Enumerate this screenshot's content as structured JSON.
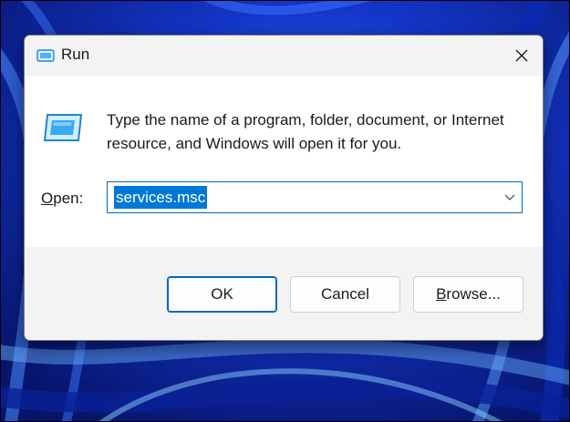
{
  "colors": {
    "wallpaper_base": "#0a1f8a",
    "accent": "#0067c0",
    "selection": "#0078d7",
    "dialog_bg": "#f3f3f3",
    "content_bg": "#ffffff"
  },
  "dialog": {
    "title": "Run",
    "title_icon": "run-icon",
    "close_icon": "close-icon",
    "program_icon": "run-program-icon",
    "description": "Type the name of a program, folder, document, or Internet resource, and Windows will open it for you.",
    "open_label_accel": "O",
    "open_label_rest": "pen:",
    "open_value": "services.msc",
    "dropdown_icon": "chevron-down-icon",
    "buttons": {
      "ok": "OK",
      "cancel": "Cancel",
      "browse_accel": "B",
      "browse_rest": "rowse..."
    }
  }
}
